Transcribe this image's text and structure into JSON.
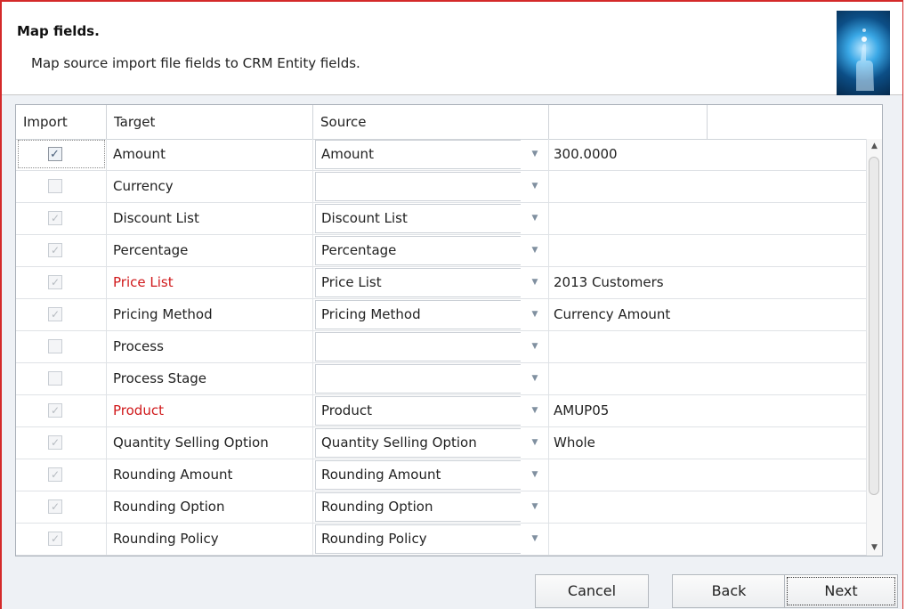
{
  "header": {
    "title": "Map fields.",
    "subtitle": "Map source import file fields to CRM Entity fields."
  },
  "grid": {
    "columns": [
      "Import",
      "Target",
      "Source",
      ""
    ],
    "rows": [
      {
        "import_checked": true,
        "enabled": true,
        "target": "Amount",
        "required": false,
        "source": "Amount",
        "value": "300.0000"
      },
      {
        "import_checked": false,
        "enabled": false,
        "target": "Currency",
        "required": false,
        "source": "",
        "value": ""
      },
      {
        "import_checked": true,
        "enabled": false,
        "target": "Discount List",
        "required": false,
        "source": "Discount List",
        "value": ""
      },
      {
        "import_checked": true,
        "enabled": false,
        "target": "Percentage",
        "required": false,
        "source": "Percentage",
        "value": ""
      },
      {
        "import_checked": true,
        "enabled": false,
        "target": "Price List",
        "required": true,
        "source": "Price List",
        "value": "2013 Customers"
      },
      {
        "import_checked": true,
        "enabled": false,
        "target": "Pricing Method",
        "required": false,
        "source": "Pricing Method",
        "value": "Currency Amount"
      },
      {
        "import_checked": false,
        "enabled": false,
        "target": "Process",
        "required": false,
        "source": "",
        "value": ""
      },
      {
        "import_checked": false,
        "enabled": false,
        "target": "Process Stage",
        "required": false,
        "source": "",
        "value": ""
      },
      {
        "import_checked": true,
        "enabled": false,
        "target": "Product",
        "required": true,
        "source": "Product",
        "value": "AMUP05"
      },
      {
        "import_checked": true,
        "enabled": false,
        "target": "Quantity Selling Option",
        "required": false,
        "source": "Quantity Selling Option",
        "value": "Whole"
      },
      {
        "import_checked": true,
        "enabled": false,
        "target": "Rounding Amount",
        "required": false,
        "source": "Rounding Amount",
        "value": ""
      },
      {
        "import_checked": true,
        "enabled": false,
        "target": "Rounding Option",
        "required": false,
        "source": "Rounding Option",
        "value": ""
      },
      {
        "import_checked": true,
        "enabled": false,
        "target": "Rounding Policy",
        "required": false,
        "source": "Rounding Policy",
        "value": ""
      }
    ]
  },
  "buttons": {
    "cancel": "Cancel",
    "back": "Back",
    "next": "Next"
  },
  "colors": {
    "frame_border": "#d42a2a",
    "required_text": "#d0191b",
    "panel_bg": "#eef1f5"
  },
  "icons": {
    "header_logo": "touch-hand-logo-icon",
    "dropdown": "chevron-down-icon",
    "scroll_up": "arrow-up-icon",
    "scroll_down": "arrow-down-icon"
  }
}
